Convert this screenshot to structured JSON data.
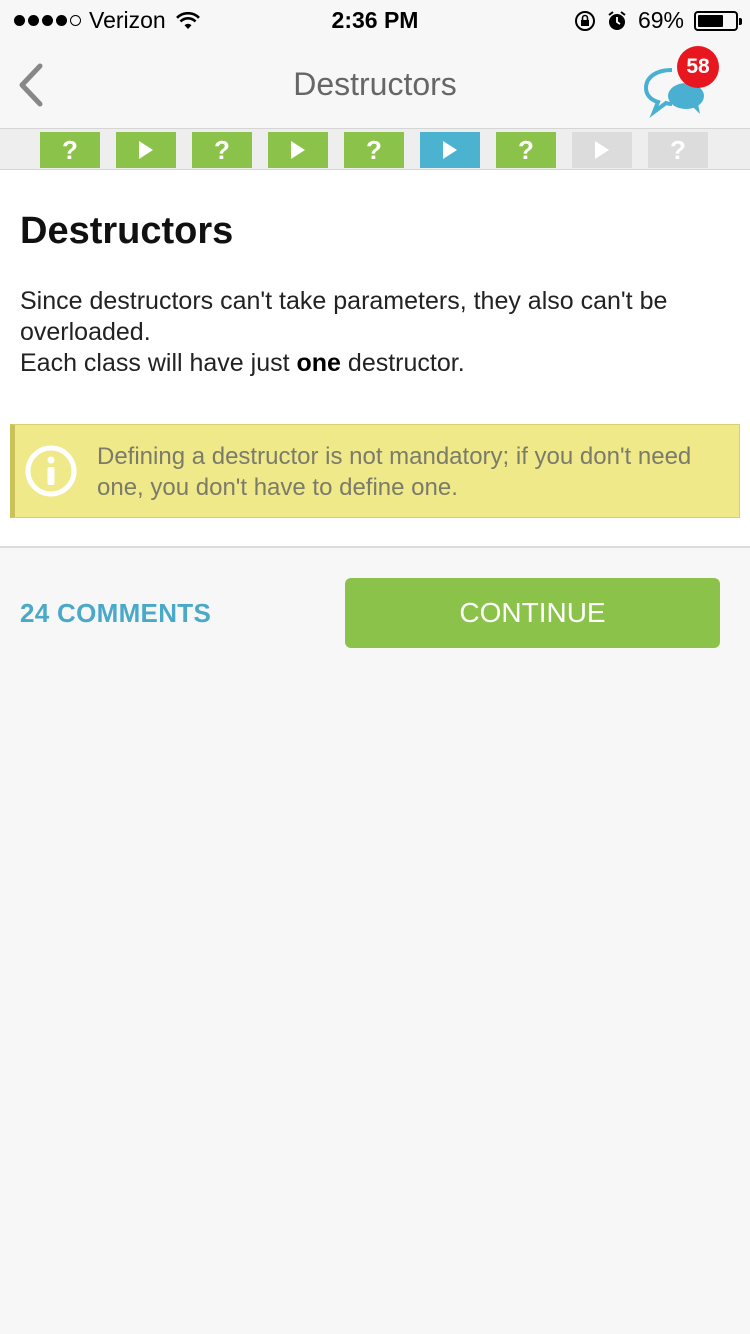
{
  "status_bar": {
    "carrier": "Verizon",
    "time": "2:36 PM",
    "battery_percent_label": "69%",
    "battery_level": 0.69
  },
  "nav": {
    "title": "Destructors",
    "badge_count": "58",
    "back_icon": "chevron-left-icon",
    "chat_icon": "chat-bubbles-icon"
  },
  "progress_steps": [
    {
      "type": "quiz",
      "label": "?",
      "state": "done"
    },
    {
      "type": "lesson",
      "label": "",
      "state": "done"
    },
    {
      "type": "quiz",
      "label": "?",
      "state": "done"
    },
    {
      "type": "lesson",
      "label": "",
      "state": "done"
    },
    {
      "type": "quiz",
      "label": "?",
      "state": "done"
    },
    {
      "type": "lesson",
      "label": "",
      "state": "current"
    },
    {
      "type": "quiz",
      "label": "?",
      "state": "done"
    },
    {
      "type": "lesson",
      "label": "",
      "state": "locked"
    },
    {
      "type": "quiz",
      "label": "?",
      "state": "locked"
    }
  ],
  "colors": {
    "done": "#8bc34a",
    "current": "#4bb3cf",
    "locked": "#dcdcdc",
    "accent_blue": "#4aa9c9",
    "info_bg": "#efe98a"
  },
  "lesson": {
    "heading": "Destructors",
    "para_line1": "Since destructors can't take parameters, they also can't be overloaded.",
    "para_line2_pre": "Each class will have just ",
    "para_line2_bold": "one",
    "para_line2_post": " destructor.",
    "info_icon": "info-icon",
    "info_text": "Defining a destructor is not mandatory; if you don't need one, you don't have to define one."
  },
  "footer": {
    "comments_label": "24 COMMENTS",
    "continue_label": "CONTINUE"
  }
}
